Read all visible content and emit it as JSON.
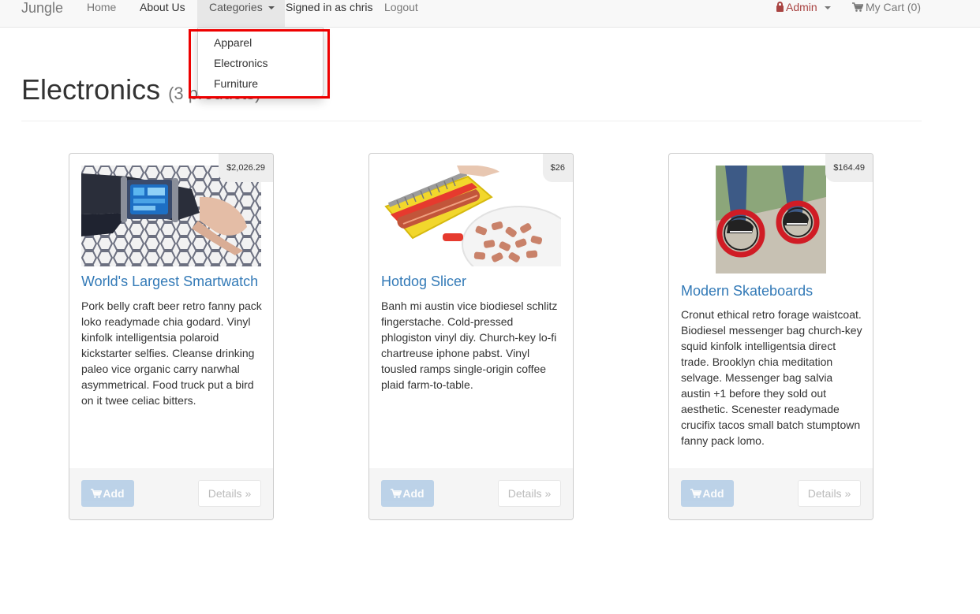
{
  "nav": {
    "brand": "Jungle",
    "home": "Home",
    "about": "About Us",
    "categories": "Categories",
    "signed_in": "Signed in as chris",
    "logout": "Logout",
    "admin": "Admin",
    "cart": "My Cart (0)"
  },
  "dropdown": {
    "items": [
      "Apparel",
      "Electronics",
      "Furniture"
    ]
  },
  "page": {
    "title": "Electronics",
    "count": "(3 products)"
  },
  "products": [
    {
      "name": "World's Largest Smartwatch",
      "price": "$2,026.29",
      "description": "Pork belly craft beer retro fanny pack loko readymade chia godard. Vinyl kinfolk intelligentsia polaroid kickstarter selfies. Cleanse drinking paleo vice organic carry narwhal asymmetrical. Food truck put a bird on it twee celiac bitters.",
      "add_label": "Add",
      "details_label": "Details »"
    },
    {
      "name": "Hotdog Slicer",
      "price": "$26",
      "description": "Banh mi austin vice biodiesel schlitz fingerstache. Cold-pressed phlogiston vinyl diy. Church-key lo-fi chartreuse iphone pabst. Vinyl tousled ramps single-origin coffee plaid farm-to-table.",
      "add_label": "Add",
      "details_label": "Details »"
    },
    {
      "name": "Modern Skateboards",
      "price": "$164.49",
      "description": "Cronut ethical retro forage waistcoat. Biodiesel messenger bag church-key squid kinfolk intelligentsia direct trade. Brooklyn chia meditation selvage. Messenger bag salvia austin +1 before they sold out aesthetic. Scenester readymade crucifix tacos small batch stumptown fanny pack lomo.",
      "add_label": "Add",
      "details_label": "Details »"
    }
  ],
  "colors": {
    "link": "#337ab7",
    "admin": "#a94442",
    "highlight": "#ee0000",
    "add_button": "#a9c7e4"
  }
}
